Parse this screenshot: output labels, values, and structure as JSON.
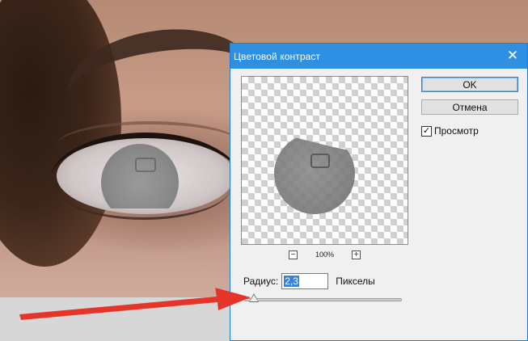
{
  "dialog": {
    "title": "Цветовой контраст",
    "close_glyph": "✕",
    "ok_label": "OK",
    "cancel_label": "Отмена",
    "preview_label": "Просмотр",
    "preview_checked": true,
    "zoom_out_glyph": "−",
    "zoom_in_glyph": "+",
    "zoom_value": "100%",
    "radius_label": "Радиус:",
    "radius_value": "2,3",
    "units_label": "Пикселы",
    "slider_level": 0.06
  },
  "colors": {
    "titlebar": "#2f8fe0",
    "arrow": "#e5352b",
    "selection": "#3a84d8"
  },
  "icons": {
    "close": "close-icon",
    "zoom_out": "minus-icon",
    "zoom_in": "plus-icon",
    "check": "checkmark-icon"
  }
}
